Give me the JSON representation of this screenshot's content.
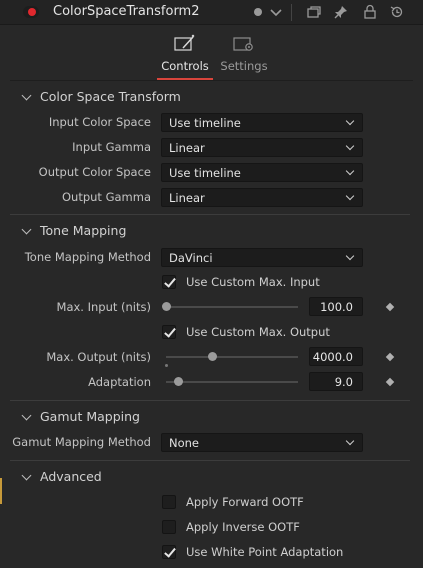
{
  "title_bar": {
    "node_name": "ColorSpaceTransform2",
    "icons": [
      "node-color-dot-icon",
      "status-dot-icon",
      "chevron-down-icon",
      "copy-icon",
      "pin-icon",
      "lock-icon",
      "reset-icon"
    ]
  },
  "tabs": [
    {
      "label": "Controls",
      "icon": "controls-wand-icon",
      "active": true
    },
    {
      "label": "Settings",
      "icon": "settings-gear-icon",
      "active": false
    }
  ],
  "sections": {
    "color_space_transform": {
      "title": "Color Space Transform",
      "input_color_space": {
        "label": "Input Color Space",
        "value": "Use timeline"
      },
      "input_gamma": {
        "label": "Input Gamma",
        "value": "Linear"
      },
      "output_color_space": {
        "label": "Output Color Space",
        "value": "Use timeline"
      },
      "output_gamma": {
        "label": "Output Gamma",
        "value": "Linear"
      }
    },
    "tone_mapping": {
      "title": "Tone Mapping",
      "method": {
        "label": "Tone Mapping Method",
        "value": "DaVinci"
      },
      "use_custom_max_input": {
        "label": "Use Custom Max. Input",
        "checked": true
      },
      "max_input": {
        "label": "Max. Input (nits)",
        "value": "100.0",
        "slider_fraction": 0.0
      },
      "use_custom_max_output": {
        "label": "Use Custom Max. Output",
        "checked": true
      },
      "max_output": {
        "label": "Max. Output (nits)",
        "value": "4000.0",
        "slider_fraction": 0.35
      },
      "adaptation": {
        "label": "Adaptation",
        "value": "9.0",
        "slider_fraction": 0.09
      }
    },
    "gamut_mapping": {
      "title": "Gamut Mapping",
      "method": {
        "label": "Gamut Mapping Method",
        "value": "None"
      }
    },
    "advanced": {
      "title": "Advanced",
      "apply_forward_ootf": {
        "label": "Apply Forward OOTF",
        "checked": false
      },
      "apply_inverse_ootf": {
        "label": "Apply Inverse OOTF",
        "checked": false
      },
      "use_white_point_adaptation": {
        "label": "Use White Point Adaptation",
        "checked": true
      }
    }
  },
  "colors": {
    "accent_red": "#e0282e",
    "tab_underline": "#d9453c",
    "panel_bg": "#282828",
    "field_bg": "#1c1c1c"
  }
}
